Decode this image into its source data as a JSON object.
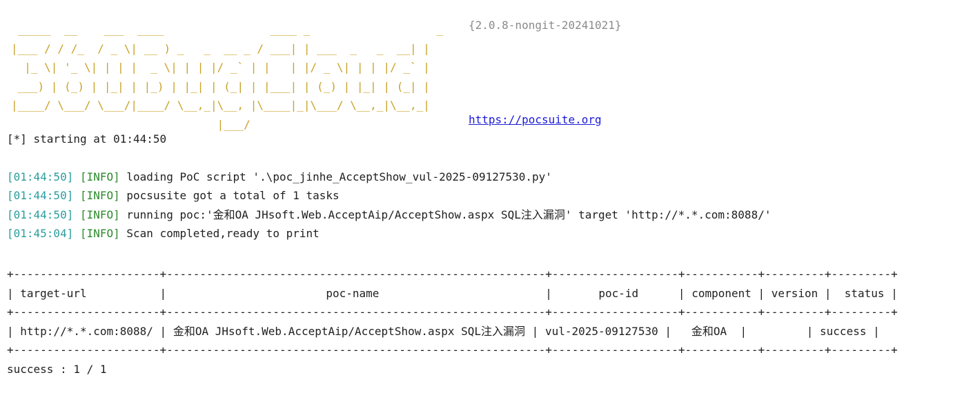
{
  "banner": {
    "lines": [
      " _____  __    ___  ____                ____ _                   _",
      "|___ / / /_  / _ \\| __ ) _   _  __ _ / ___| | ___  _   _  __| |",
      "  |_ \\| '_ \\| | | |  _ \\| | | |/ _` | |   | |/ _ \\| | | |/ _` |",
      " ___) | (_) | |_| | |_) | |_| | (_| | |___| | (_) | |_| | (_| |",
      "|____/ \\___/ \\___/|____/ \\__,_|\\__, |\\____|_|\\___/ \\__,_|\\__,_|",
      "                               |___/"
    ],
    "version": "{2.0.8-nongit-20241021}",
    "url": "https://pocsuite.org"
  },
  "start_line": "[*] starting at 01:44:50",
  "log": [
    {
      "time": "[01:44:50]",
      "level": "[INFO]",
      "message": "loading PoC script '.\\poc_jinhe_AcceptShow_vul-2025-09127530.py'"
    },
    {
      "time": "[01:44:50]",
      "level": "[INFO]",
      "message": "pocsusite got a total of 1 tasks"
    },
    {
      "time": "[01:44:50]",
      "level": "[INFO]",
      "message": "running poc:'金和OA JHsoft.Web.AcceptAip/AcceptShow.aspx SQL注入漏洞' target 'http://*.*.com:8088/'"
    },
    {
      "time": "[01:45:04]",
      "level": "[INFO]",
      "message": "Scan completed,ready to print"
    }
  ],
  "results_table": {
    "headers": [
      "target-url",
      "poc-name",
      "poc-id",
      "component",
      "version",
      "status"
    ],
    "rows": [
      [
        "http://*.*.com:8088/",
        "金和OA JHsoft.Web.AcceptAip/AcceptShow.aspx SQL注入漏洞",
        "vul-2025-09127530",
        "金和OA",
        "",
        "success"
      ]
    ]
  },
  "summary": "success : 1 / 1",
  "colors": {
    "banner": "#c9a227",
    "version": "#8a8a8a",
    "link": "#1a1ad8",
    "timestamp": "#2a9d9d",
    "level": "#2c8a2c",
    "text": "#1f1f1f"
  }
}
